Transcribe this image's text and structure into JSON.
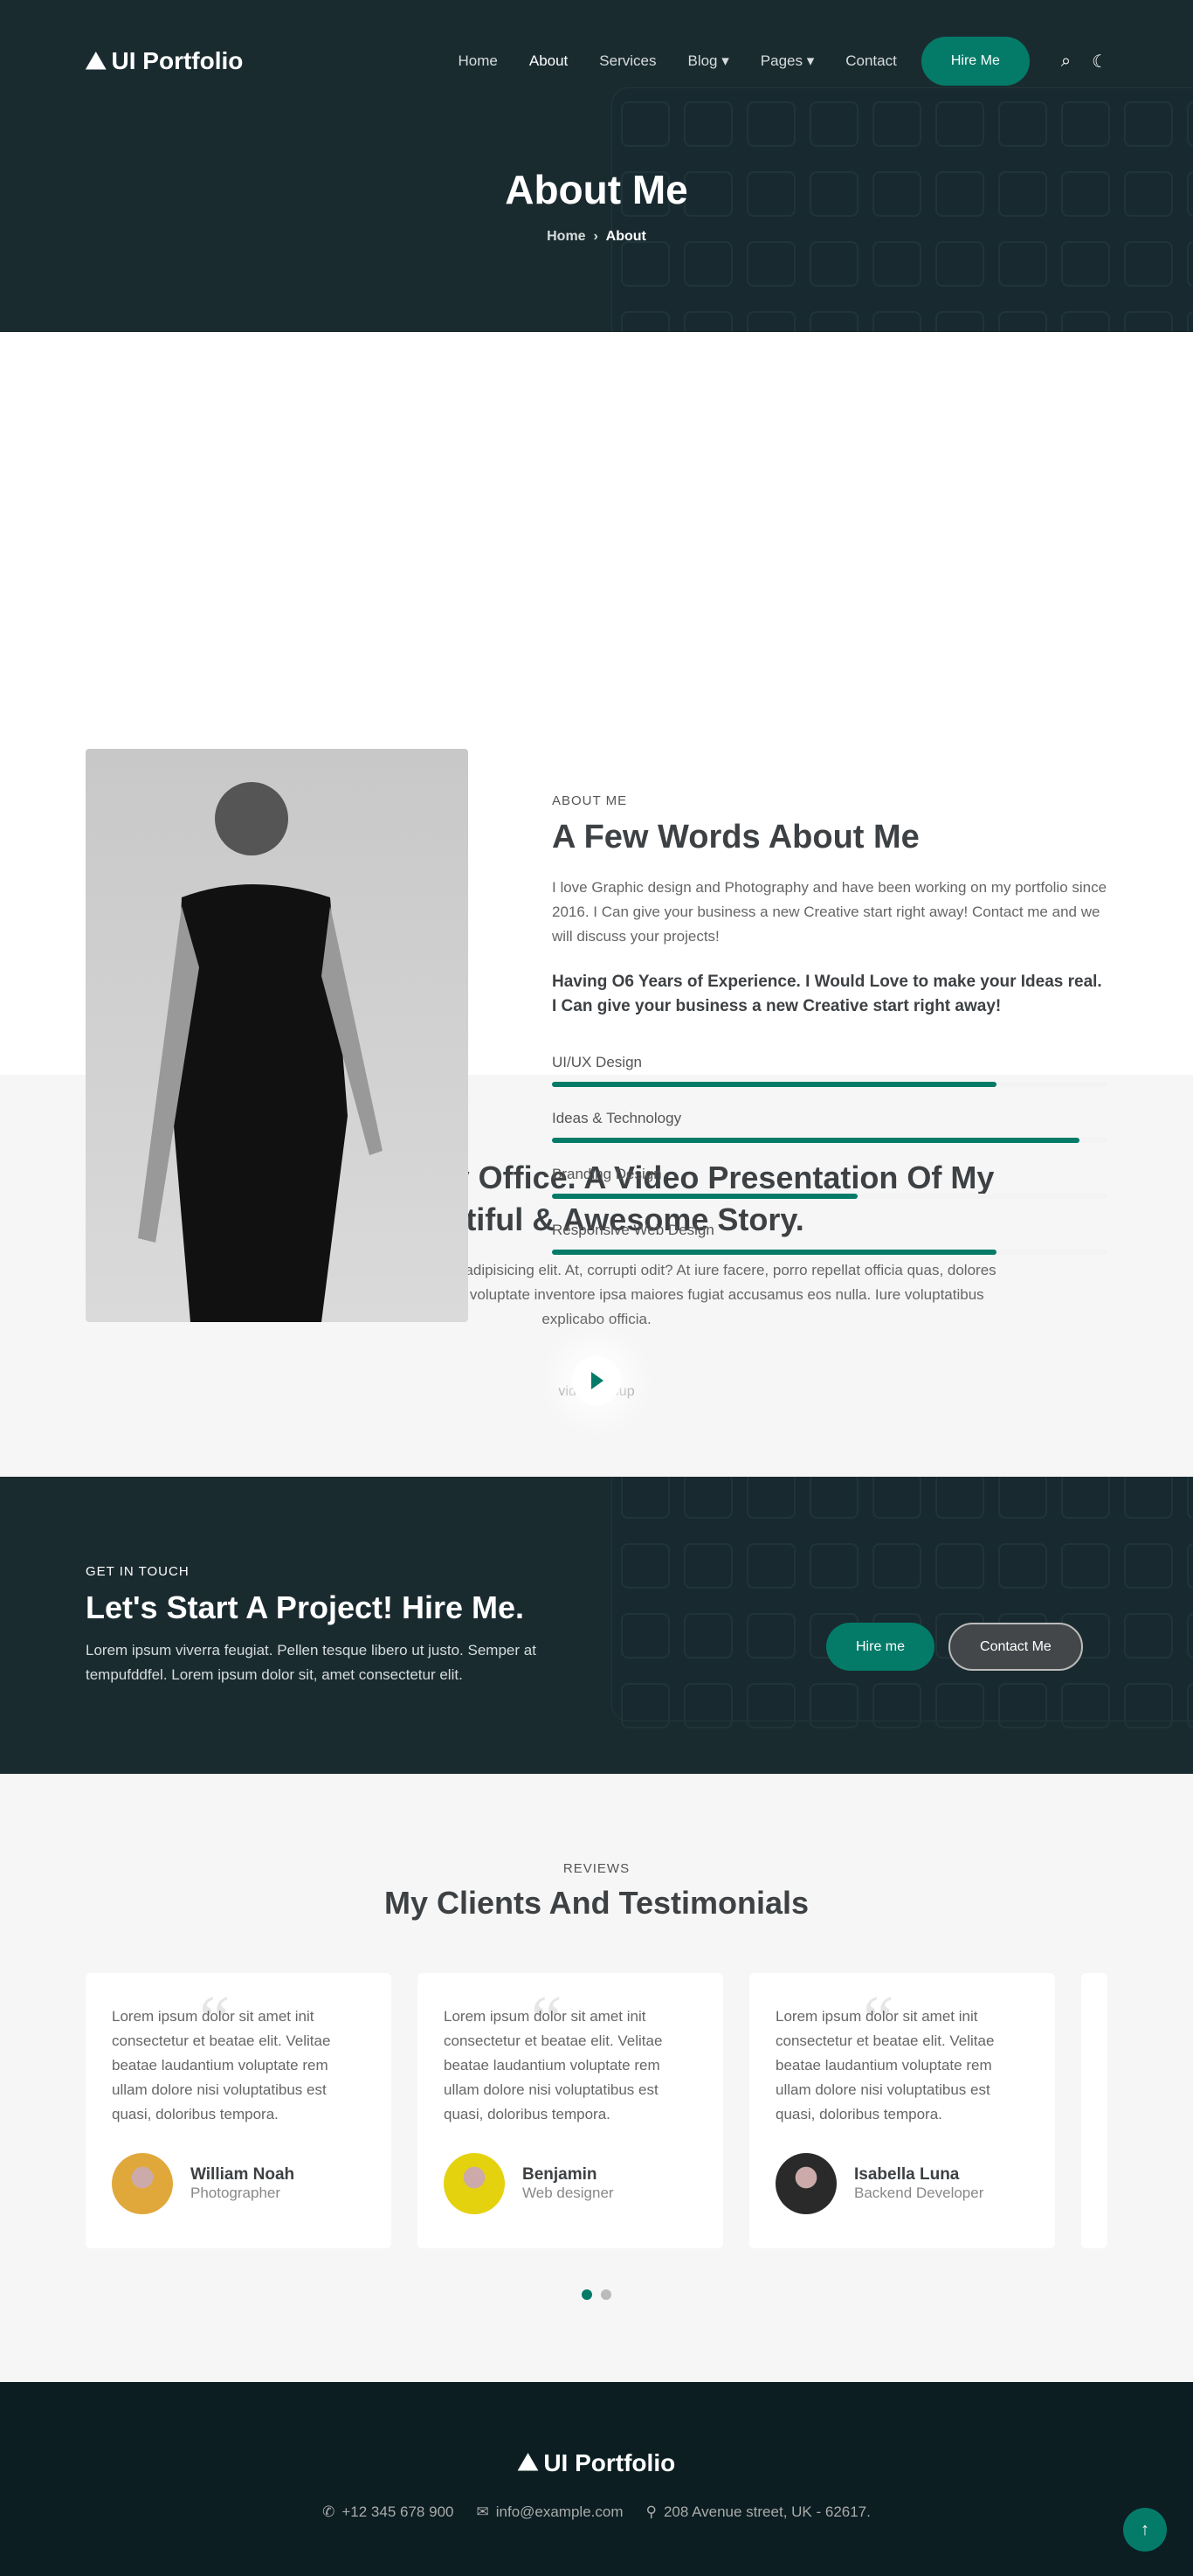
{
  "brand": "UI Portfolio",
  "colors": {
    "accent": "#047b68",
    "dark": "#1a2b30",
    "footer": "#0c1e22"
  },
  "nav": {
    "items": [
      "Home",
      "About",
      "Services",
      "Blog",
      "Pages",
      "Contact"
    ],
    "hire": "Hire Me",
    "active": "About"
  },
  "hero": {
    "title": "About Me",
    "crumb_home": "Home",
    "crumb_sep": "›",
    "crumb_current": "About"
  },
  "about": {
    "eyebrow": "ABOUT ME",
    "title": "A Few Words About Me",
    "para": "I love Graphic design and Photography and have been working on my portfolio since 2016. I Can give your business a new Creative start right away! Contact me and we will discuss your projects!",
    "bold": "Having O6 Years of Experience. I Would Love to make your Ideas real. I Can give your business a new Creative start right away!",
    "skills": [
      {
        "label": "UI/UX Design",
        "percent": 80
      },
      {
        "label": "Ideas & Technology",
        "percent": 95
      },
      {
        "label": "Branding Design",
        "percent": 55
      },
      {
        "label": "Responsive Web Design",
        "percent": 80
      }
    ]
  },
  "video": {
    "title": "Take A Tour Of My Office. A Video Presentation Of My Beautiful & Awesome Story.",
    "para": "Lorem ipsum, dolor sit amet consectetur adipisicing elit. At, corrupti odit? At iure facere, porro repellat officia quas, dolores magnam assumenda soluta odit harum voluptate inventore ipsa maiores fugiat accusamus eos nulla. Iure voluptatibus explicabo officia.",
    "popup": "video popup"
  },
  "cta": {
    "eyebrow": "GET IN TOUCH",
    "title": "Let's Start A Project! Hire Me.",
    "para": "Lorem ipsum viverra feugiat. Pellen tesque libero ut justo. Semper at tempufddfel. Lorem ipsum dolor sit, amet consectetur elit.",
    "hire": "Hire me",
    "contact": "Contact Me"
  },
  "reviews": {
    "eyebrow": "REVIEWS",
    "title": "My Clients And Testimonials",
    "items": [
      {
        "text": "Lorem ipsum dolor sit amet init consectetur et beatae elit. Velitae beatae laudantium voluptate rem ullam dolore nisi voluptatibus est quasi, doloribus tempora.",
        "name": "William Noah",
        "role": "Photographer"
      },
      {
        "text": "Lorem ipsum dolor sit amet init consectetur et beatae elit. Velitae beatae laudantium voluptate rem ullam dolore nisi voluptatibus est quasi, doloribus tempora.",
        "name": "Benjamin",
        "role": "Web designer"
      },
      {
        "text": "Lorem ipsum dolor sit amet init consectetur et beatae elit. Velitae beatae laudantium voluptate rem ullam dolore nisi voluptatibus est quasi, doloribus tempora.",
        "name": "Isabella Luna",
        "role": "Backend Developer"
      }
    ],
    "active_page": 1,
    "pages": 2
  },
  "footer": {
    "phone": "+12 345 678 900",
    "email": "info@example.com",
    "address": "208 Avenue street, UK - 62617."
  }
}
